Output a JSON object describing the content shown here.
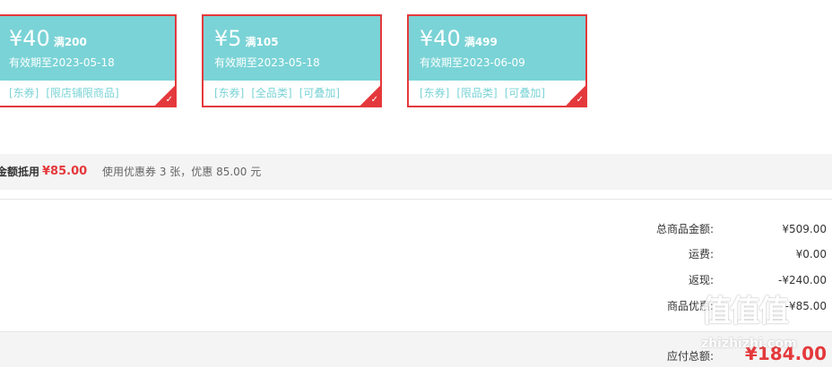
{
  "coupons": [
    {
      "amount": "¥40",
      "condition": "满200",
      "expiry": "有效期至2023-05-18",
      "tags": [
        "[东券]",
        "[限店铺限商品]"
      ]
    },
    {
      "amount": "¥5",
      "condition": "满105",
      "expiry": "有效期至2023-05-18",
      "tags": [
        "[东券]",
        "[全品类]",
        "[可叠加]"
      ]
    },
    {
      "amount": "¥40",
      "condition": "满499",
      "expiry": "有效期至2023-06-09",
      "tags": [
        "[东券]",
        "[限品类]",
        "[可叠加]"
      ]
    }
  ],
  "summary": {
    "label": "金额抵用",
    "amount": "¥85.00",
    "description": "使用优惠券 3 张，优惠 85.00 元"
  },
  "totals": [
    {
      "label": "总商品金额:",
      "value": "¥509.00"
    },
    {
      "label": "运费:",
      "value": "¥0.00"
    },
    {
      "label": "返现:",
      "value": "-¥240.00"
    },
    {
      "label": "商品优惠:",
      "value": "-¥85.00"
    }
  ],
  "payable": {
    "label": "应付总额:",
    "value": "¥184.00"
  },
  "watermark": {
    "logo": "值值值",
    "site": "zhizhizhi.com"
  },
  "colors": {
    "accent": "#e4393c",
    "coupon": "#7ad3d6",
    "bar": "#f4f4f4"
  }
}
